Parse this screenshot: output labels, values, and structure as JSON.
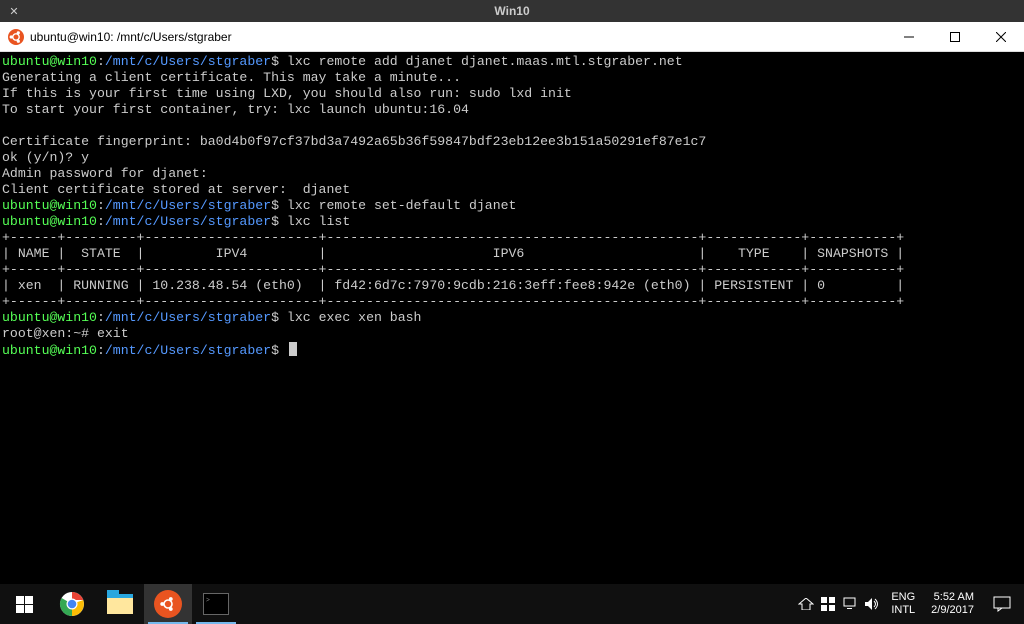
{
  "vm": {
    "close": "✕",
    "title": "Win10"
  },
  "window": {
    "title": "ubuntu@win10: /mnt/c/Users/stgraber"
  },
  "prompt": {
    "user_host": "ubuntu@win10",
    "colon": ":",
    "path": "/mnt/c/Users/stgraber",
    "dollar": "$"
  },
  "root_prompt": "root@xen:~# ",
  "cmds": {
    "remote_add": " lxc remote add djanet djanet.maas.mtl.stgraber.net",
    "set_default": " lxc remote set-default djanet",
    "list": " lxc list",
    "exec": " lxc exec xen bash",
    "exit": "exit",
    "empty": " "
  },
  "output": {
    "gen_cert": "Generating a client certificate. This may take a minute...",
    "first_time": "If this is your first time using LXD, you should also run: sudo lxd init",
    "first_container": "To start your first container, try: lxc launch ubuntu:16.04",
    "fingerprint": "Certificate fingerprint: ba0d4b0f97cf37bd3a7492a65b36f59847bdf23eb12ee3b151a50291ef87e1c7",
    "ok_prompt": "ok (y/n)? y",
    "admin_pw": "Admin password for djanet:",
    "cert_stored": "Client certificate stored at server:  djanet"
  },
  "table": {
    "border_top": "+------+---------+----------------------+-----------------------------------------------+------------+-----------+",
    "header": "| NAME |  STATE  |         IPV4         |                     IPV6                      |    TYPE    | SNAPSHOTS |",
    "border_mid": "+------+---------+----------------------+-----------------------------------------------+------------+-----------+",
    "row": "| xen  | RUNNING | 10.238.48.54 (eth0)  | fd42:6d7c:7970:9cdb:216:3eff:fee8:942e (eth0) | PERSISTENT | 0         |",
    "border_bot": "+------+---------+----------------------+-----------------------------------------------+------------+-----------+"
  },
  "taskbar": {
    "lang1": "ENG",
    "lang2": "INTL",
    "time": "5:52 AM",
    "date": "2/9/2017"
  }
}
